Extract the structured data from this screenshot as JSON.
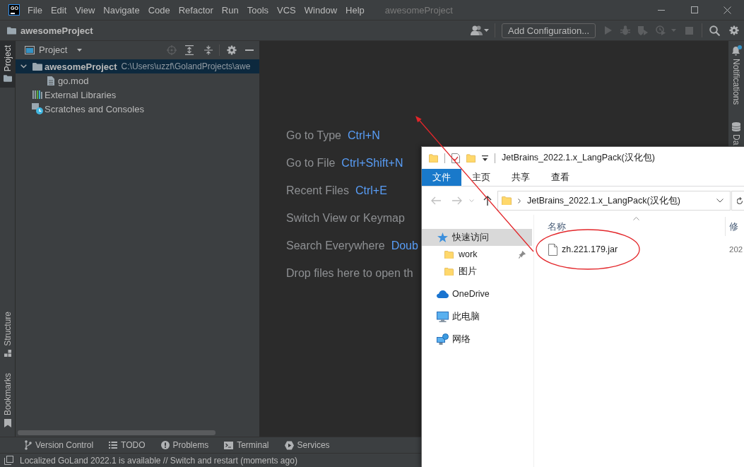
{
  "app_logo": "GO",
  "menu": [
    "File",
    "Edit",
    "View",
    "Navigate",
    "Code",
    "Refactor",
    "Run",
    "Tools",
    "VCS",
    "Window",
    "Help"
  ],
  "window": {
    "title": "awesomeProject"
  },
  "navigation_bar": {
    "project": "awesomeProject",
    "run_configuration": "Add Configuration..."
  },
  "left_stripe": [
    {
      "label": "Project",
      "kind": "project",
      "selected": true
    },
    {
      "label": "Structure",
      "kind": "structure",
      "selected": false
    },
    {
      "label": "Bookmarks",
      "kind": "bookmarks",
      "selected": false
    }
  ],
  "project_panel": {
    "title": "Project",
    "tree": [
      {
        "label": "awesomeProject",
        "kind": "module",
        "path": "C:\\Users\\uzzf\\GolandProjects\\awe",
        "expanded": true,
        "selected": true,
        "children": [
          {
            "label": "go.mod",
            "kind": "file",
            "selected": false
          }
        ]
      },
      {
        "label": "External Libraries",
        "kind": "libraries",
        "selected": false
      },
      {
        "label": "Scratches and Consoles",
        "kind": "scratches",
        "selected": false
      }
    ]
  },
  "welcome_actions": [
    {
      "action": "Go to Type",
      "shortcut": "Ctrl+N"
    },
    {
      "action": "Go to File",
      "shortcut": "Ctrl+Shift+N"
    },
    {
      "action": "Recent Files",
      "shortcut": "Ctrl+E"
    },
    {
      "action": "Switch View or Keymap"
    },
    {
      "action": "Search Everywhere",
      "shortcut": "Doub"
    },
    {
      "action": "Drop files here to open th"
    }
  ],
  "right_stripe": [
    {
      "label": "Notifications",
      "kind": "notifications",
      "unread": true
    },
    {
      "label": "Da",
      "kind": "database"
    }
  ],
  "tool_windows": [
    {
      "label": "Version Control",
      "kind": "vcs"
    },
    {
      "label": "TODO",
      "kind": "todo"
    },
    {
      "label": "Problems",
      "kind": "problems"
    },
    {
      "label": "Terminal",
      "kind": "terminal"
    },
    {
      "label": "Services",
      "kind": "services"
    }
  ],
  "status_bar": {
    "message": "Localized GoLand 2022.1 is available // Switch and restart (moments ago)"
  },
  "file_explorer": {
    "title": "JetBrains_2022.1.x_LangPack(汉化包)",
    "ribbon_tabs": [
      {
        "label": "文件",
        "selected": true
      },
      {
        "label": "主页",
        "selected": false
      },
      {
        "label": "共享",
        "selected": false
      },
      {
        "label": "查看",
        "selected": false
      }
    ],
    "address": "JetBrains_2022.1.x_LangPack(汉化包)",
    "nav": [
      {
        "label": "快速访问",
        "kind": "quick-access",
        "selected": true,
        "children": [
          {
            "label": "work",
            "kind": "folder",
            "pinned": true,
            "selected": false
          },
          {
            "label": "图片",
            "kind": "folder",
            "pinned": false,
            "selected": false
          }
        ]
      },
      {
        "label": "OneDrive",
        "kind": "cloud",
        "selected": false
      },
      {
        "label": "此电脑",
        "kind": "computer",
        "selected": false
      },
      {
        "label": "网络",
        "kind": "network",
        "selected": false
      }
    ],
    "columns": [
      {
        "label": "名称",
        "sorted": true
      },
      {
        "label": "修",
        "sorted": false
      }
    ],
    "files": [
      {
        "name": "zh.221.179.jar",
        "modified": "202"
      }
    ]
  },
  "annotations": [
    {
      "kind": "arrow"
    },
    {
      "kind": "ellipse"
    }
  ]
}
